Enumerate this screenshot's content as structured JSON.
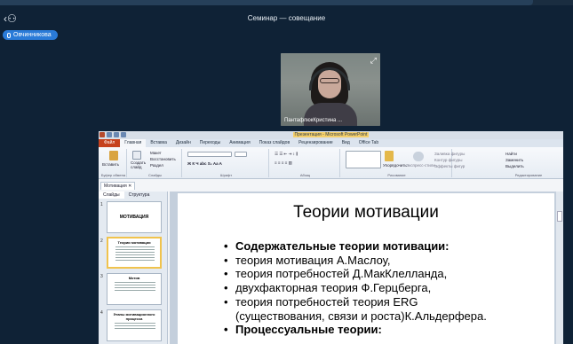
{
  "meeting": {
    "title": "Семинар — совещание",
    "back_icon": "person-back-icon",
    "speaker_badge": "Овчинникова"
  },
  "video": {
    "participant_name": "ПантафлюкКристина ...",
    "expand_icon": "expand-icon"
  },
  "powerpoint": {
    "window_title": "Презентация - Microsoft PowerPoint",
    "ribbon_tabs": [
      "Файл",
      "Главная",
      "Вставка",
      "Дизайн",
      "Переходы",
      "Анимация",
      "Показ слайдов",
      "Рецензирование",
      "Вид",
      "Office Tab"
    ],
    "active_tab": "Главная",
    "ribbon_groups": {
      "clipboard": "Буфер обмена",
      "slides": "Слайды",
      "font": "Шрифт",
      "paragraph": "Абзац",
      "drawing": "Рисование",
      "editing": "Редактирование"
    },
    "ribbon_labels": {
      "paste": "Вставить",
      "new_slide": "Создать слайд",
      "layout": "Макет",
      "reset": "Восстановить",
      "section": "Раздел",
      "arrange": "Упорядочить",
      "quick_styles": "Экспресс-стили",
      "shape_fill": "Заливка фигуры",
      "shape_outline": "Контур фигуры",
      "shape_effects": "Эффекты фигур",
      "find": "Найти",
      "replace": "Заменить",
      "select": "Выделить"
    },
    "doc_tab": "Мотивация",
    "pane_tabs": [
      "Слайды",
      "Структура"
    ],
    "thumbnails": [
      {
        "num": "1",
        "title": "МОТИВАЦИЯ"
      },
      {
        "num": "2",
        "title": "Теории мотивации"
      },
      {
        "num": "3",
        "title": "Мотив"
      },
      {
        "num": "4",
        "title": "Этапы мотивационного процесса"
      }
    ],
    "slide": {
      "title": "Теории мотивации",
      "bullets": [
        {
          "text": "Содержательные теории мотивации:",
          "bold": true
        },
        {
          "text": "теория мотивация А.Маслоу,",
          "bold": false
        },
        {
          "text": "теория потребностей Д.МакКлелланда,",
          "bold": false
        },
        {
          "text": "двухфакторная теория Ф.Герцберга,",
          "bold": false
        },
        {
          "text": "теория потребностей теория ERG",
          "bold": false
        },
        {
          "text": "(существования, связи и роста)К.Альдерфера.",
          "bold": false,
          "continuation": true
        },
        {
          "text": "Процессуальные теории:",
          "bold": true
        }
      ]
    }
  }
}
